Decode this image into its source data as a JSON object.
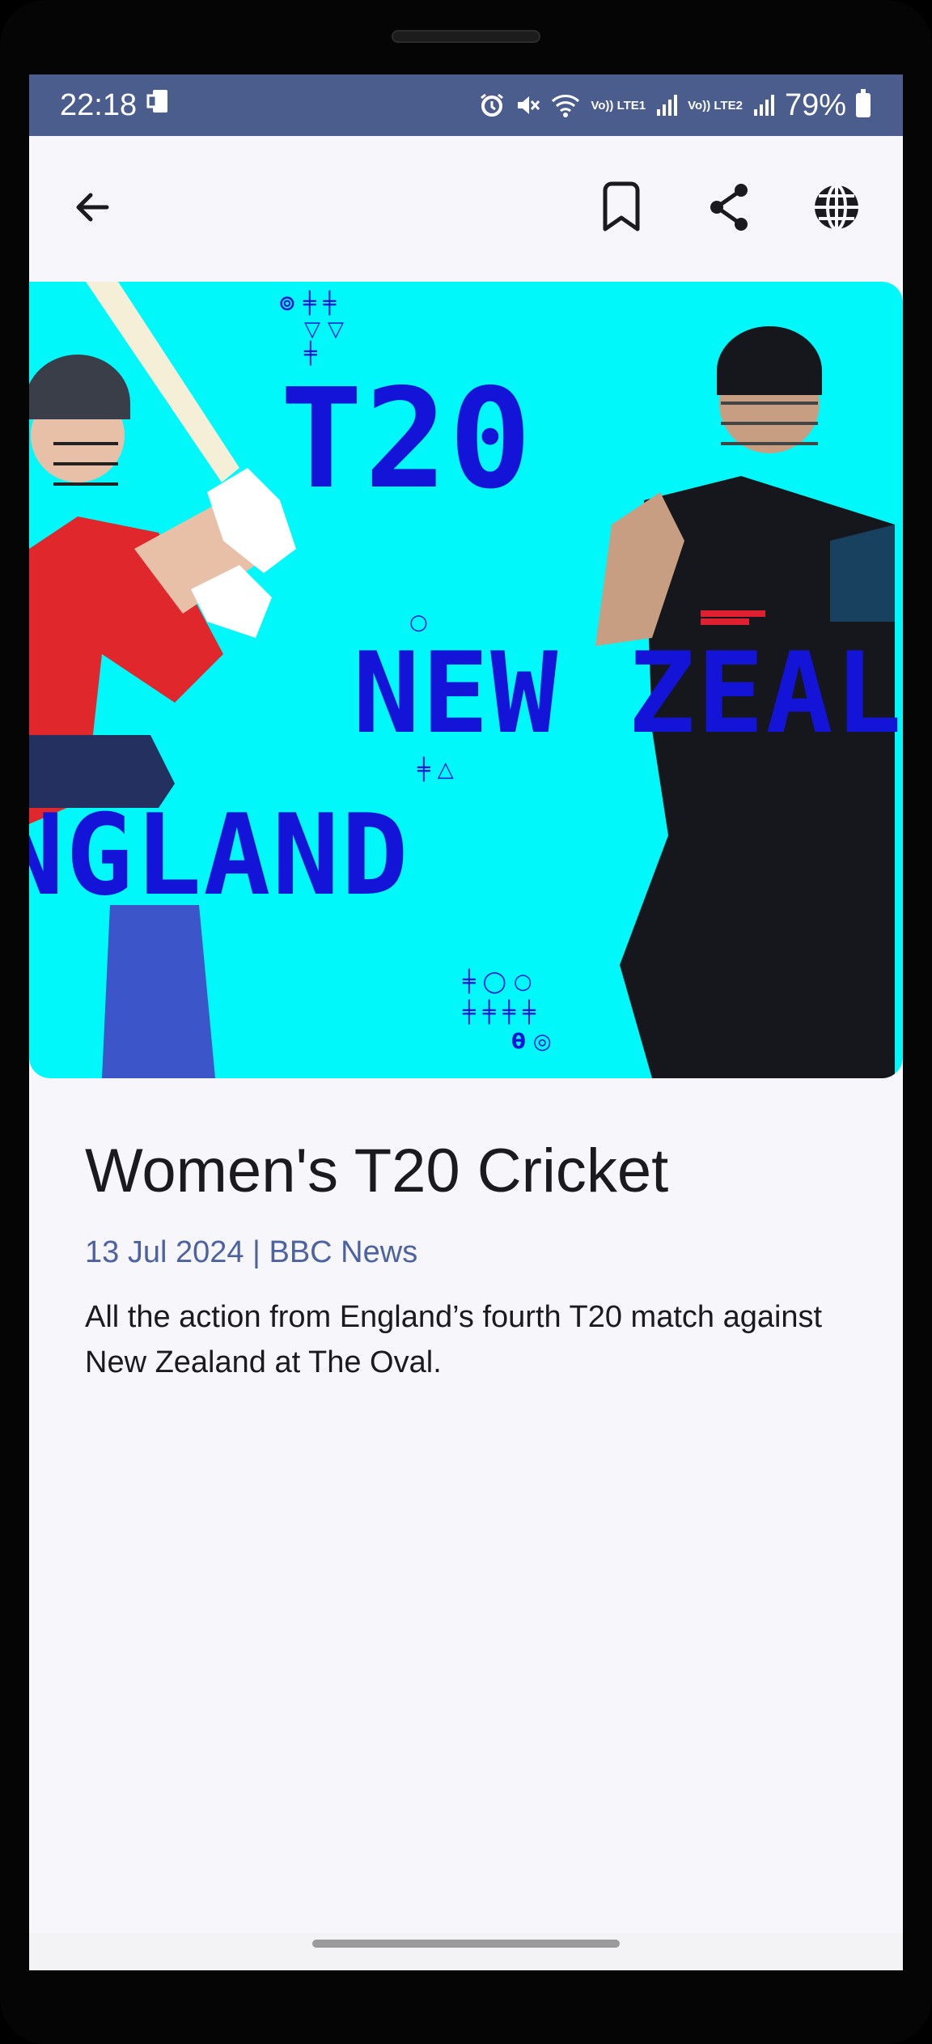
{
  "status_bar": {
    "time": "22:18",
    "battery": "79%",
    "sim1": "Vo)) LTE1",
    "sim2": "Vo)) LTE2",
    "icons": [
      "device-icon",
      "alarm-icon",
      "mute-icon",
      "wifi-icon",
      "signal-icon",
      "battery-icon"
    ]
  },
  "toolbar": {
    "icons": [
      "back-arrow-icon",
      "bookmark-icon",
      "share-icon",
      "globe-icon"
    ]
  },
  "hero": {
    "headline_t20": "T20",
    "headline_nz": "NEW ZEAL",
    "headline_eng": "NGLAND"
  },
  "article": {
    "title": "Women's T20 Cricket",
    "meta": "13 Jul 2024 | BBC News",
    "summary": "All the action from England’s fourth T20 match against New Zealand at The Oval."
  },
  "colors": {
    "status_bar": "#4a5d8c",
    "hero_bg": "#00f8fa",
    "hero_text": "#1414d8",
    "meta_text": "#4c63a0",
    "england_red": "#e0282c",
    "nz_black": "#15171c"
  }
}
